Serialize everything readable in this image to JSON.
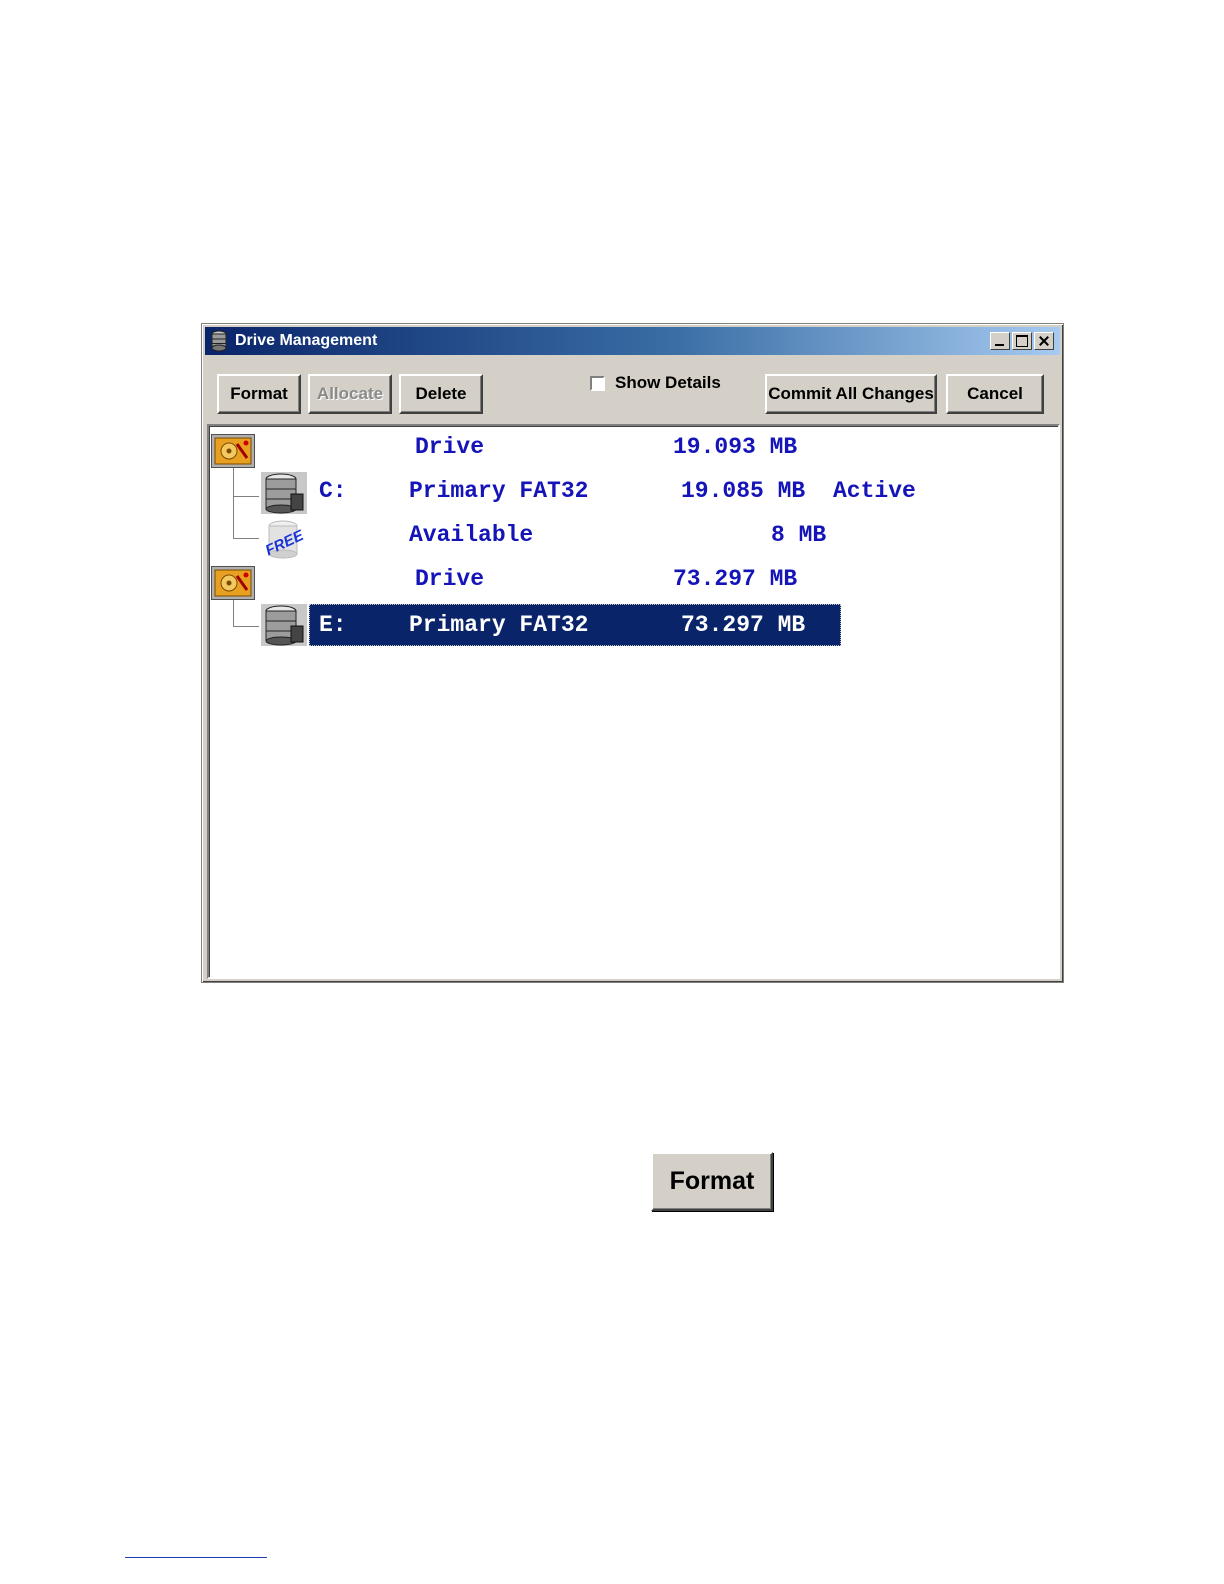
{
  "window": {
    "title": "Drive Management",
    "title_icon": "disk-stack-icon",
    "controls": [
      "minimize-icon",
      "maximize-icon",
      "close-icon"
    ]
  },
  "toolbar": {
    "format_label": "Format",
    "allocate_label": "Allocate",
    "delete_label": "Delete",
    "show_details_label": "Show Details",
    "show_details_checked": false,
    "commit_label": "Commit All Changes",
    "cancel_label": "Cancel"
  },
  "tree": {
    "rows": [
      {
        "kind": "drive",
        "icon": "hard-drive-icon",
        "letter": "",
        "type": "Drive",
        "size": "19.093 MB",
        "status": ""
      },
      {
        "kind": "partition",
        "icon": "partition-icon",
        "letter": "C:",
        "type": "Primary FAT32",
        "size": "19.085 MB",
        "status": "Active"
      },
      {
        "kind": "free",
        "icon": "free-space-icon",
        "letter": "",
        "type": "Available",
        "size": "8 MB",
        "status": ""
      },
      {
        "kind": "drive",
        "icon": "hard-drive-icon",
        "letter": "",
        "type": "Drive",
        "size": "73.297 MB",
        "status": ""
      },
      {
        "kind": "partition",
        "icon": "partition-icon",
        "letter": "E:",
        "type": "Primary FAT32",
        "size": "73.297 MB",
        "status": "",
        "selected": true
      }
    ],
    "free_icon_text": "FREE"
  },
  "standalone": {
    "format_label": "Format"
  },
  "colors": {
    "title_gradient_start": "#0a246a",
    "title_gradient_end": "#a6caf0",
    "row_text": "#1414b8",
    "selection": "#0a246a",
    "face": "#d4d0c8"
  }
}
